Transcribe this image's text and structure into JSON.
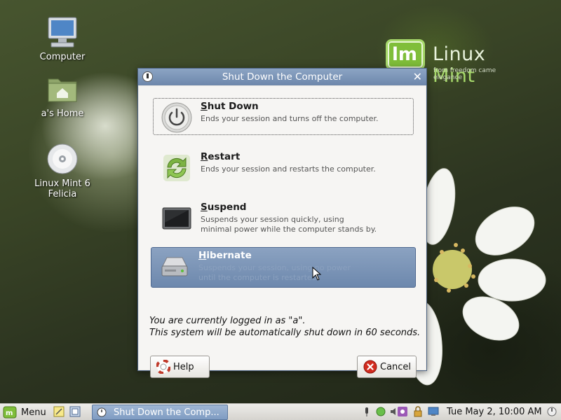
{
  "desktop": {
    "logo": {
      "brand": "Linux Mint",
      "tagline": "from freedom came elegance"
    },
    "icons": [
      {
        "label": "Computer",
        "icon": "computer-icon"
      },
      {
        "label": "a's Home",
        "icon": "home-folder-icon"
      },
      {
        "label": "Linux Mint 6 Felicia",
        "icon": "cd-disc-icon"
      }
    ]
  },
  "dialog": {
    "title": "Shut Down the Computer",
    "options": [
      {
        "title": "Shut Down",
        "mnemonic": "S",
        "rest": "hut Down",
        "description": [
          "Ends your session and turns off the computer."
        ],
        "icon": "power-icon",
        "state": "focused"
      },
      {
        "title": "Restart",
        "mnemonic": "R",
        "rest": "estart",
        "description": [
          "Ends your session and restarts the computer."
        ],
        "icon": "restart-icon",
        "state": "normal"
      },
      {
        "title": "Suspend",
        "mnemonic": "S",
        "rest": "uspend",
        "description": [
          "Suspends your session quickly, using",
          "minimal power while the computer stands by."
        ],
        "icon": "suspend-monitor-icon",
        "state": "normal"
      },
      {
        "title": "Hibernate",
        "mnemonic": "H",
        "rest": "ibernate",
        "description": [
          "Suspends your session, using no power",
          "until the computer is restarted."
        ],
        "icon": "hard-drive-icon",
        "state": "hover"
      }
    ],
    "status_line1": "You are currently logged in as \"a\".",
    "status_line2": "This system will be automatically shut down in 60 seconds.",
    "help_label": "Help",
    "cancel_label": "Cancel"
  },
  "panel": {
    "menu_label": "Menu",
    "task_label": "Shut Down the Comp...",
    "clock": "Tue May  2, 10:00 AM"
  },
  "colors": {
    "titlebar": "#7b95b8",
    "hover_option": "#7c95b7",
    "mint_green": "#8cc63f"
  }
}
